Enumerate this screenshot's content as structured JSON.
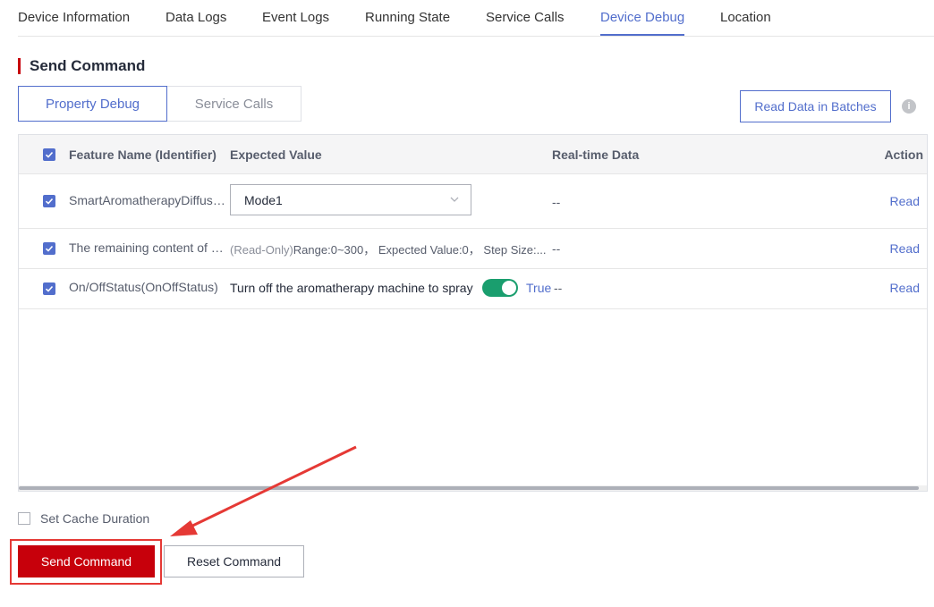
{
  "tabs": [
    {
      "label": "Device Information"
    },
    {
      "label": "Data Logs"
    },
    {
      "label": "Event Logs"
    },
    {
      "label": "Running State"
    },
    {
      "label": "Service Calls"
    },
    {
      "label": "Device Debug",
      "active": true
    },
    {
      "label": "Location"
    }
  ],
  "section_title": "Send Command",
  "subtabs": {
    "property_debug": "Property Debug",
    "service_calls": "Service Calls"
  },
  "batch_button": "Read Data in Batches",
  "info_icon": "i",
  "table": {
    "headers": {
      "feature": "Feature Name (Identifier)",
      "expected": "Expected Value",
      "realtime": "Real-time Data",
      "action": "Action"
    },
    "rows": [
      {
        "feature": "SmartAromatherapyDiffuser...",
        "expected": "Mode1",
        "realtime": "--",
        "action": "Read"
      },
      {
        "feature": "The remaining content of es...",
        "expected_prefix": "(Read-Only)",
        "expected": "Range:0~300， Expected Value:0， Step Size:...",
        "realtime": "--",
        "action": "Read"
      },
      {
        "feature": "On/OffStatus(OnOffStatus)",
        "expected": "Turn off the aromatherapy machine to spray",
        "toggle_on": true,
        "toggle_label": "True",
        "realtime": "--",
        "action": "Read"
      }
    ]
  },
  "cache_label": "Set Cache Duration",
  "send_button": "Send Command",
  "reset_button": "Reset Command",
  "colors": {
    "accent": "#526ecc",
    "primary": "#c7000b",
    "toggle": "#1a9e6e",
    "annotation": "#e53935"
  }
}
